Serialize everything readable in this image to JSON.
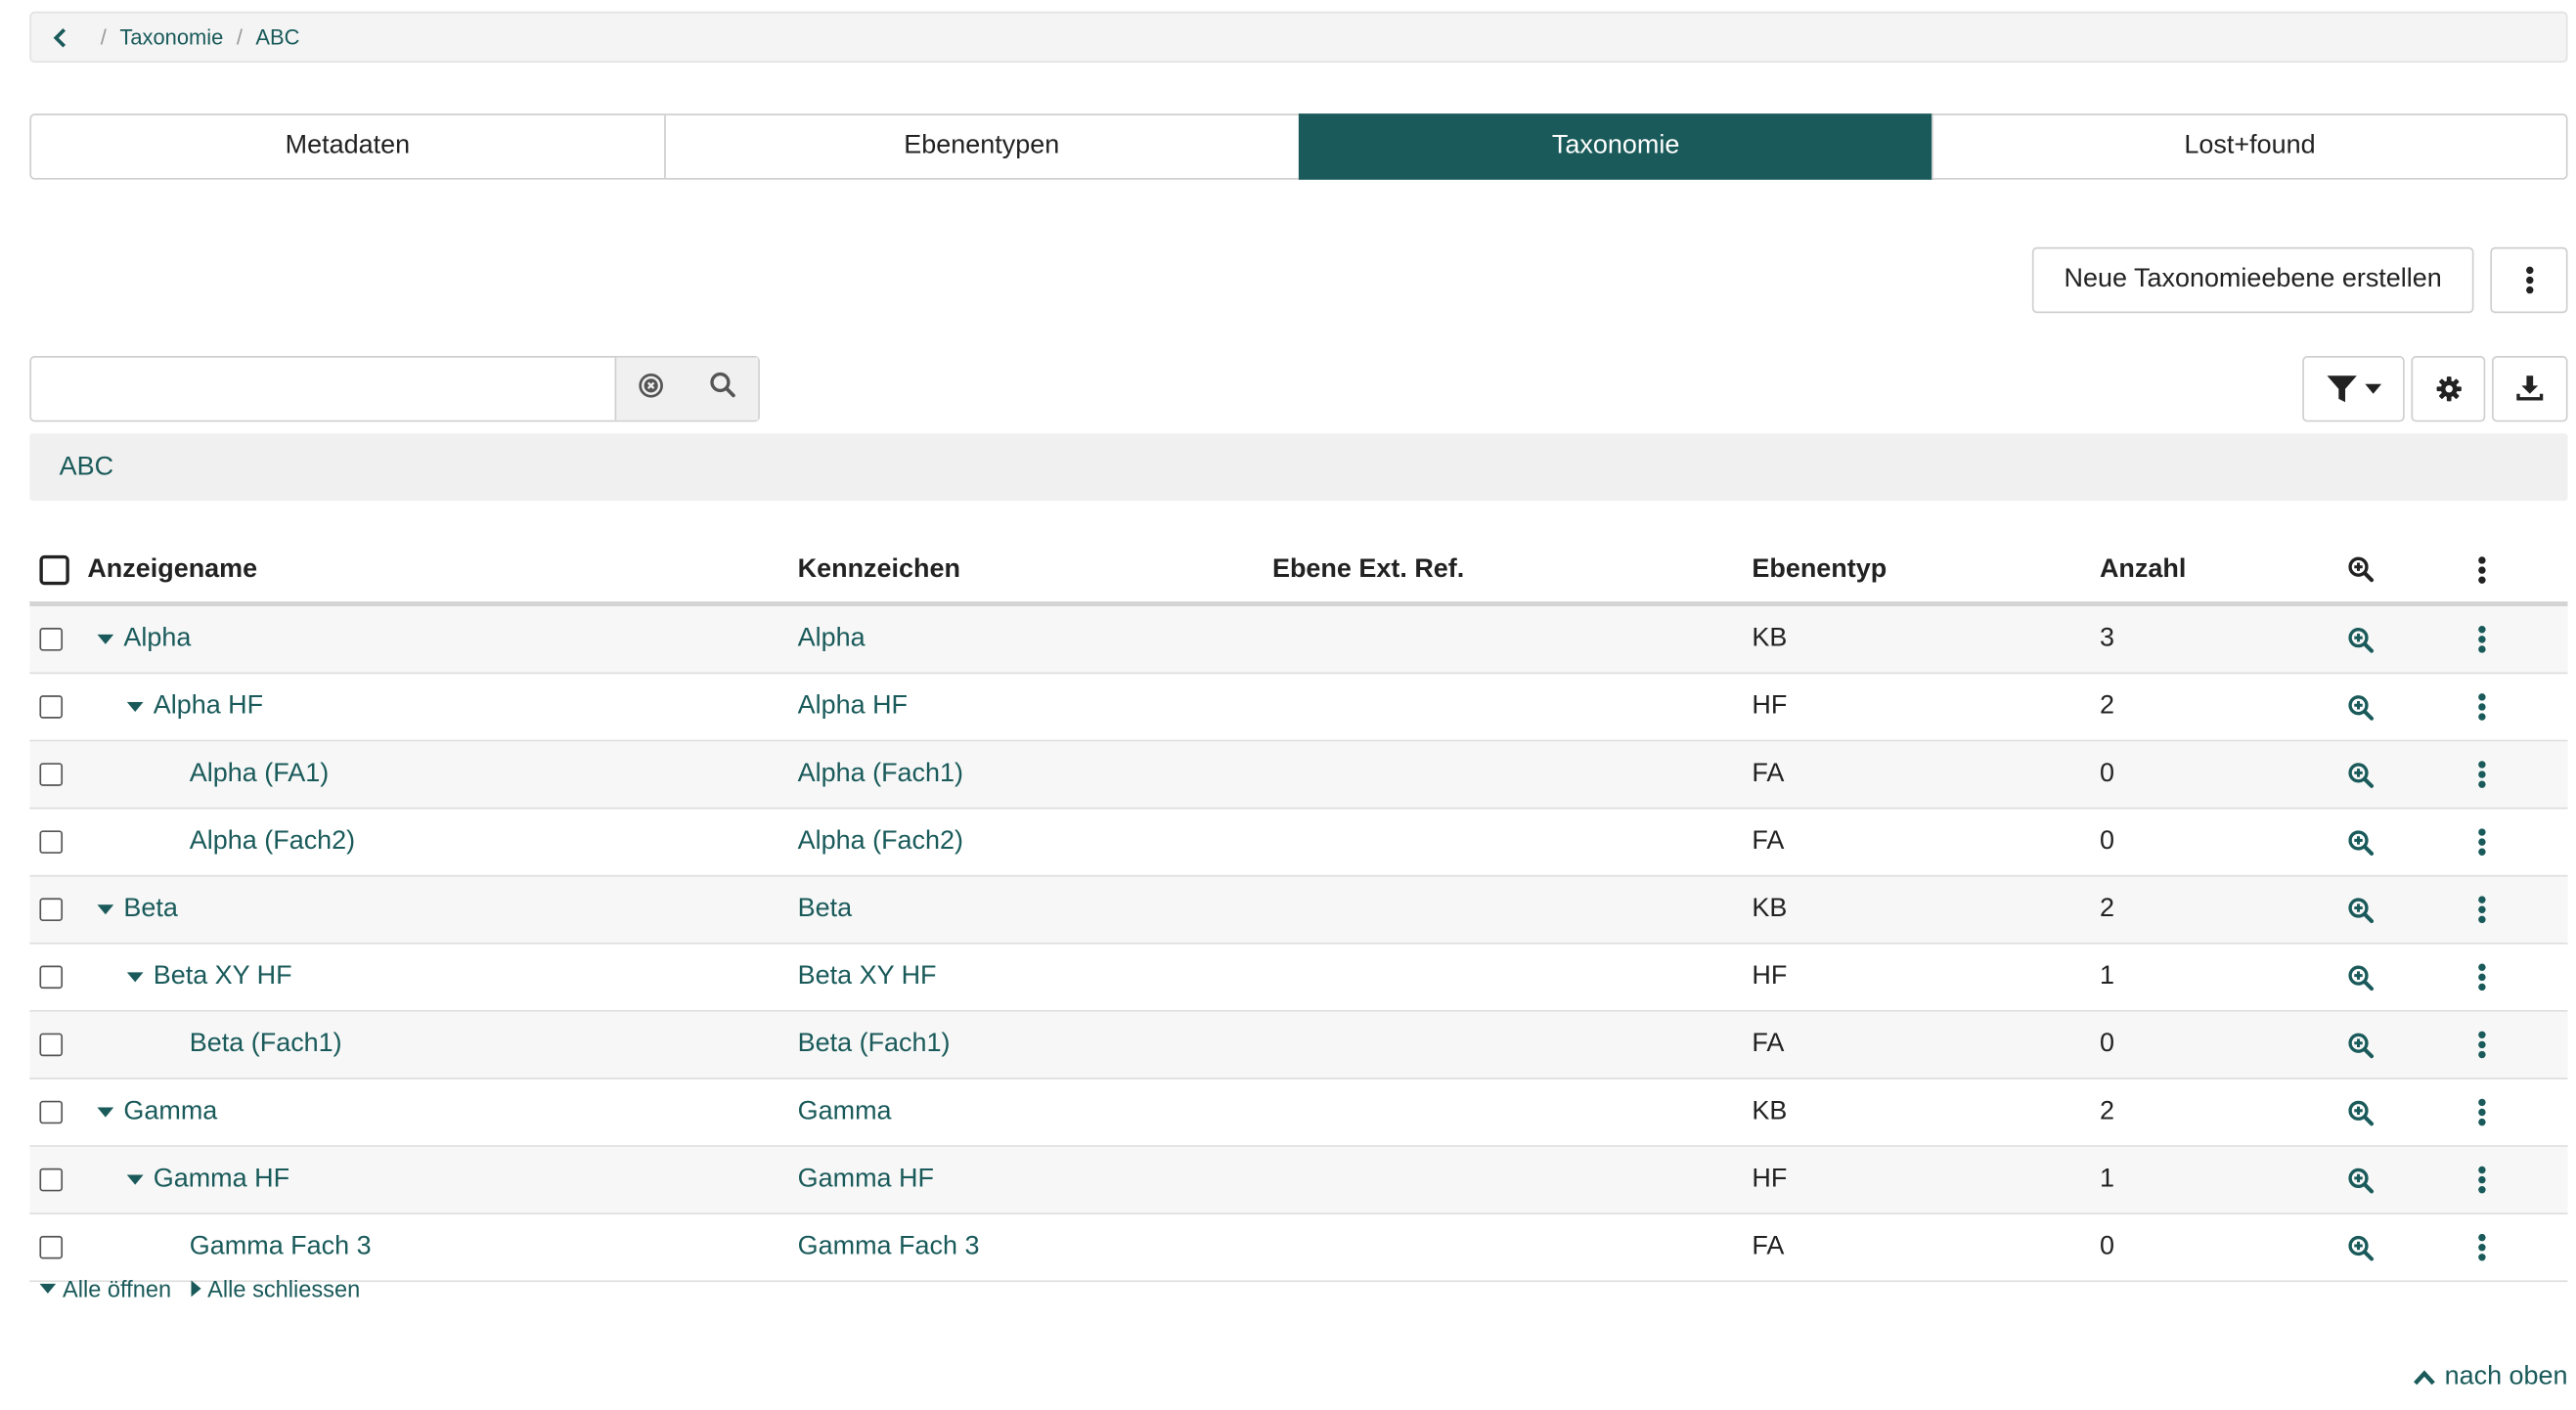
{
  "breadcrumb": {
    "items": [
      "Taxonomie",
      "ABC"
    ]
  },
  "tabs": [
    {
      "label": "Metadaten",
      "active": false
    },
    {
      "label": "Ebenentypen",
      "active": false
    },
    {
      "label": "Taxonomie",
      "active": true
    },
    {
      "label": "Lost+found",
      "active": false
    }
  ],
  "toolbar": {
    "create_label": "Neue Taxonomieebene erstellen"
  },
  "search": {
    "value": "",
    "placeholder": ""
  },
  "path": {
    "label": "ABC"
  },
  "table": {
    "columns": {
      "name": "Anzeigename",
      "kennzeichen": "Kennzeichen",
      "ref": "Ebene Ext. Ref.",
      "typ": "Ebenentyp",
      "anzahl": "Anzahl"
    },
    "rows": [
      {
        "name": "Alpha",
        "kennzeichen": "Alpha",
        "ref": "",
        "typ": "KB",
        "anzahl": "3",
        "level": 0,
        "expandable": true
      },
      {
        "name": "Alpha HF",
        "kennzeichen": "Alpha HF",
        "ref": "",
        "typ": "HF",
        "anzahl": "2",
        "level": 1,
        "expandable": true
      },
      {
        "name": "Alpha (FA1)",
        "kennzeichen": "Alpha (Fach1)",
        "ref": "",
        "typ": "FA",
        "anzahl": "0",
        "level": 2,
        "expandable": false
      },
      {
        "name": "Alpha (Fach2)",
        "kennzeichen": "Alpha (Fach2)",
        "ref": "",
        "typ": "FA",
        "anzahl": "0",
        "level": 2,
        "expandable": false
      },
      {
        "name": "Beta",
        "kennzeichen": "Beta",
        "ref": "",
        "typ": "KB",
        "anzahl": "2",
        "level": 0,
        "expandable": true
      },
      {
        "name": "Beta XY HF",
        "kennzeichen": "Beta XY HF",
        "ref": "",
        "typ": "HF",
        "anzahl": "1",
        "level": 1,
        "expandable": true
      },
      {
        "name": "Beta (Fach1)",
        "kennzeichen": "Beta (Fach1)",
        "ref": "",
        "typ": "FA",
        "anzahl": "0",
        "level": 2,
        "expandable": false
      },
      {
        "name": "Gamma",
        "kennzeichen": "Gamma",
        "ref": "",
        "typ": "KB",
        "anzahl": "2",
        "level": 0,
        "expandable": true
      },
      {
        "name": "Gamma HF",
        "kennzeichen": "Gamma HF",
        "ref": "",
        "typ": "HF",
        "anzahl": "1",
        "level": 1,
        "expandable": true
      },
      {
        "name": "Gamma Fach 3",
        "kennzeichen": "Gamma Fach 3",
        "ref": "",
        "typ": "FA",
        "anzahl": "0",
        "level": 2,
        "expandable": false
      }
    ]
  },
  "tree": {
    "open_all": "Alle öffnen",
    "close_all": "Alle schliessen"
  },
  "footer": {
    "to_top": "nach oben"
  },
  "colors": {
    "accent": "#1a5a5a",
    "active_tab_text": "#ffffff",
    "row_stripe": "#f7f7f7"
  }
}
